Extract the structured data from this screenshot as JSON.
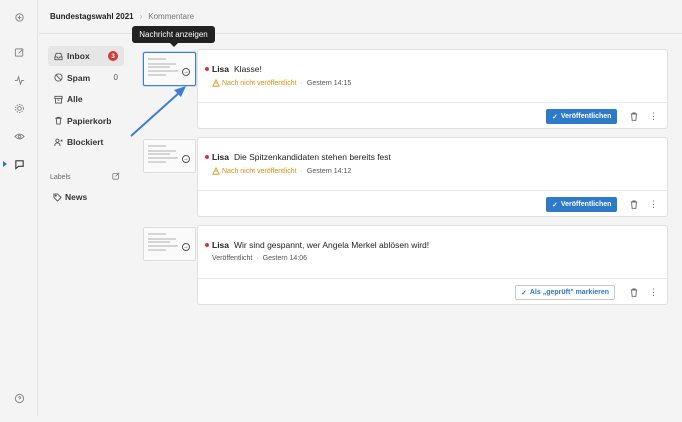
{
  "app": {
    "project": "Bundestagswahl 2021",
    "breadcrumb": "Kommentare"
  },
  "rail": {
    "icons": [
      "logo-icon",
      "edit-icon",
      "activity-icon",
      "settings-icon",
      "eye-icon",
      "comments-icon",
      "help-icon"
    ],
    "active": "comments-icon",
    "accent_color": "#2c7ac9"
  },
  "sidebar": {
    "items": [
      {
        "label": "Inbox",
        "badge": "3",
        "icon": "inbox-icon"
      },
      {
        "label": "Spam",
        "count": "0",
        "icon": "spam-icon"
      },
      {
        "label": "Alle",
        "icon": "archive-icon"
      },
      {
        "label": "Papierkorb",
        "icon": "trash-icon"
      },
      {
        "label": "Blockiert",
        "icon": "block-user-icon"
      }
    ],
    "labels_heading": "Labels",
    "labels": [
      {
        "label": "News",
        "icon": "tag-icon"
      }
    ]
  },
  "tooltip": "Nachricht anzeigen",
  "comments": [
    {
      "author": "Lisa",
      "text": "Klasse!",
      "status": "Nach nicht veröffentlicht",
      "status_color": "#d4900f",
      "time": "Gestern 14:15",
      "action": "Veröffentlichen"
    },
    {
      "author": "Lisa",
      "text": "Die Spitzenkandidaten stehen bereits fest",
      "status": "Nach nicht veröffentlicht",
      "status_color": "#d4900f",
      "time": "Gestern 14:12",
      "action": "Veröffentlichen"
    },
    {
      "author": "Lisa",
      "text": "Wir sind gespannt, wer Angela Merkel ablösen wird!",
      "status": "Veröffentlicht",
      "status_color": "#555555",
      "time": "Gestern 14:06",
      "action": "Als „geprüft\" markieren"
    }
  ],
  "colors": {
    "primary": "#2c7ac9",
    "badge": "#d23a3a",
    "unread_dot": "#d23a3a",
    "warning": "#d4900f"
  }
}
